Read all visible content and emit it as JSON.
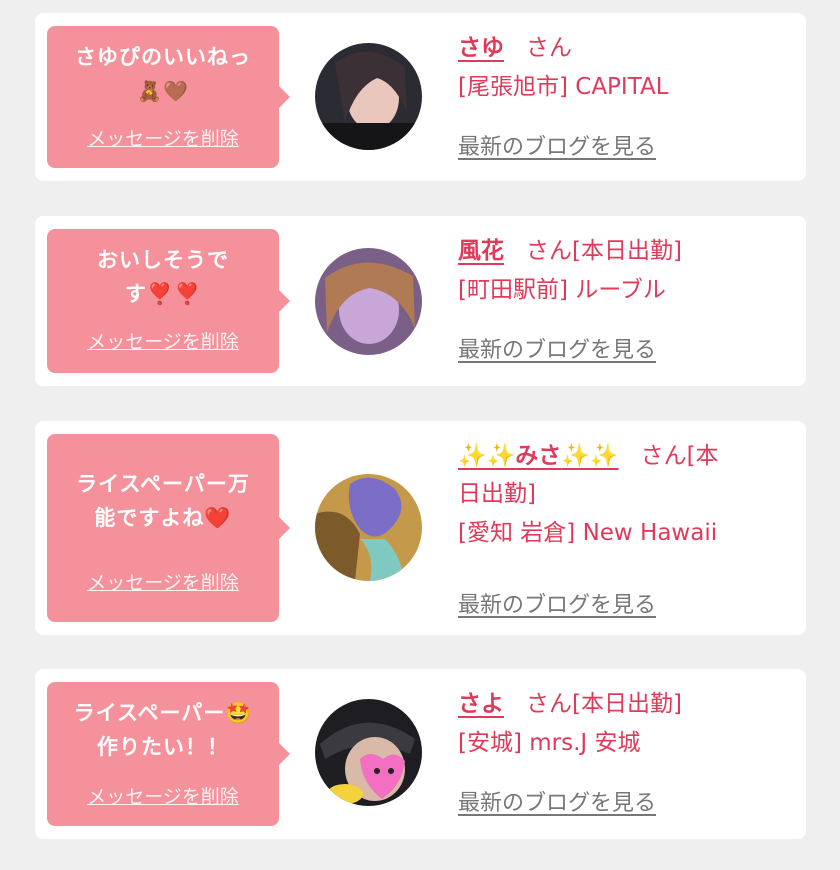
{
  "common": {
    "delete_label": "メッセージを削除",
    "san": "さん",
    "blog_label": "最新のブログを見る"
  },
  "colors": {
    "bubble": "#f5919a",
    "accent": "#e03a5a",
    "link_gray": "#777777",
    "background": "#efefef"
  },
  "items": [
    {
      "message_line1": "さゆぴのいいねっ",
      "message_emoji": "🧸🤎",
      "name": "さゆ",
      "status": "",
      "shop": "[尾張旭市] CAPITAL"
    },
    {
      "message_line1": "おいしそうで",
      "message_line2": "す❣️❣️",
      "name": "風花",
      "status": "[本日出勤]",
      "shop": "[町田駅前] ルーブル"
    },
    {
      "message_line1": "ライスペーパー万",
      "message_line2": "能ですよね❤️",
      "name_spark_left": "✨✨",
      "name": "みさ",
      "name_spark_right": "✨✨",
      "status_line1": "[本",
      "status_line2": "日出勤]",
      "shop": "[愛知 岩倉] New Hawaii"
    },
    {
      "message_line1": "ライスペーパー🤩",
      "message_line2": "作りたい！！",
      "name": "さよ",
      "status": "[本日出勤]",
      "shop": "[安城] mrs.J 安城"
    }
  ]
}
